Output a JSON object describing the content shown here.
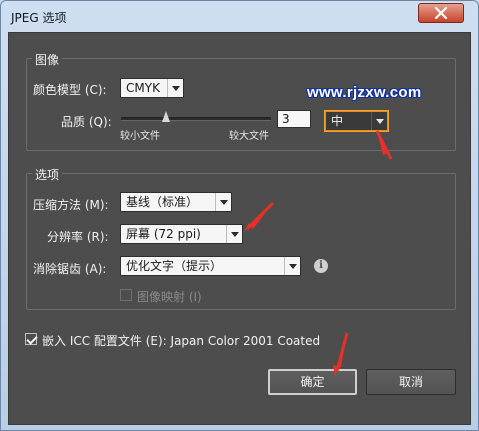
{
  "window": {
    "title": "JPEG 选项"
  },
  "image_group": {
    "legend": "图像",
    "color_model_label": "颜色模型 (C):",
    "color_model_value": "CMYK",
    "quality_label": "品质 (Q):",
    "quality_value": "3",
    "quality_preset": "中",
    "slider_min_label": "较小文件",
    "slider_max_label": "较大文件"
  },
  "options_group": {
    "legend": "选项",
    "compression_label": "压缩方法 (M):",
    "compression_value": "基线（标准）",
    "resolution_label": "分辨率 (R):",
    "resolution_value": "屏幕 (72 ppi)",
    "antialias_label": "消除锯齿 (A):",
    "antialias_value": "优化文字（提示）",
    "imagemap_label": "图像映射 (I)"
  },
  "icc": {
    "label": "嵌入 ICC 配置文件 (E): Japan Color 2001 Coated",
    "checked": true
  },
  "buttons": {
    "ok": "确定",
    "cancel": "取消"
  },
  "watermark": "www.rjzxw.com",
  "colors": {
    "panel": "#4d4d4d",
    "highlight": "#f08a1a",
    "arrow": "#e8302a",
    "watermark_outline": "#1030a0"
  }
}
